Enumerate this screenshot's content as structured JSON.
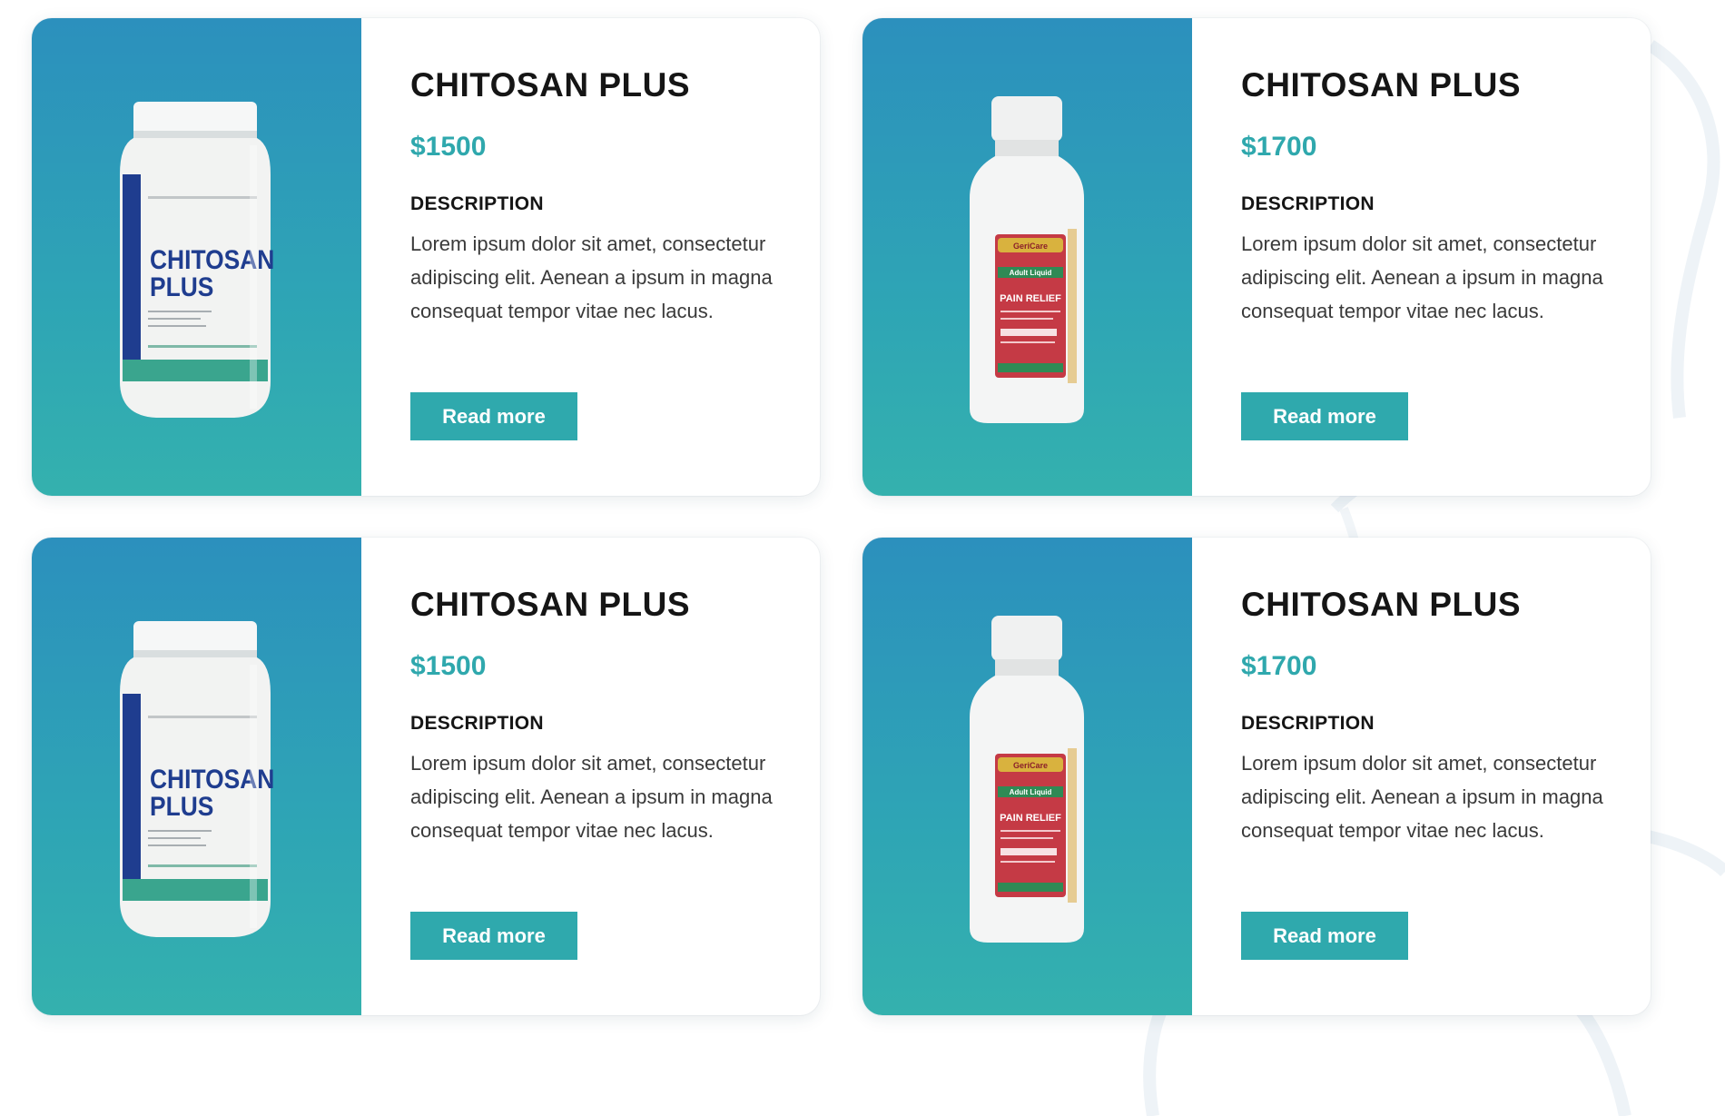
{
  "colors": {
    "accent": "#2fa9ad",
    "price": "#2fa8ad",
    "media_gradient_top": "#2c90bd",
    "media_gradient_bottom": "#34b1ae",
    "title": "#151515",
    "body_text": "#3a3a3a"
  },
  "products": [
    {
      "title": "CHITOSAN PLUS",
      "price": "$1500",
      "description_heading": "DESCRIPTION",
      "description": "Lorem ipsum dolor sit amet, consectetur adipiscing elit. Aenean a ipsum in magna consequat tempor vitae nec lacus.",
      "button_label": "Read more",
      "image": "chitosan-plus-bottle-image",
      "image_label": [
        "CHITOSAN",
        "PLUS"
      ]
    },
    {
      "title": "CHITOSAN PLUS",
      "price": "$1700",
      "description_heading": "DESCRIPTION",
      "description": "Lorem ipsum dolor sit amet, consectetur adipiscing elit. Aenean a ipsum in magna consequat tempor vitae nec lacus.",
      "button_label": "Read more",
      "image": "pain-relief-liquid-bottle-image",
      "image_label": [
        "GeriCare",
        "PAIN RELIEF",
        "Adult Liquid"
      ]
    },
    {
      "title": "CHITOSAN PLUS",
      "price": "$1500",
      "description_heading": "DESCRIPTION",
      "description": "Lorem ipsum dolor sit amet, consectetur adipiscing elit. Aenean a ipsum in magna consequat tempor vitae nec lacus.",
      "button_label": "Read more",
      "image": "chitosan-plus-bottle-image",
      "image_label": [
        "CHITOSAN",
        "PLUS"
      ]
    },
    {
      "title": "CHITOSAN PLUS",
      "price": "$1700",
      "description_heading": "DESCRIPTION",
      "description": "Lorem ipsum dolor sit amet, consectetur adipiscing elit. Aenean a ipsum in magna consequat tempor vitae nec lacus.",
      "button_label": "Read more",
      "image": "pain-relief-liquid-bottle-image",
      "image_label": [
        "GeriCare",
        "PAIN RELIEF",
        "Adult Liquid"
      ]
    }
  ]
}
